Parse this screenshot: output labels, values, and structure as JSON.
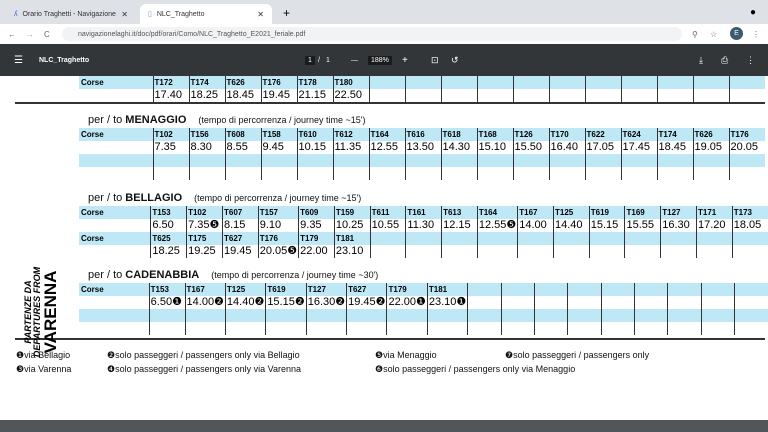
{
  "browser": {
    "tabs": [
      {
        "title": "Orario Traghetti - Navigazione",
        "active": false
      },
      {
        "title": "NLC_Traghetto",
        "active": true
      }
    ],
    "url": "navigazionelaghi.it/doc/pdf/orari/Como/NLC_Traghetto_E2021_feriale.pdf",
    "avatar": "E"
  },
  "pdf": {
    "title": "NLC_Traghetto",
    "page": "1",
    "pages": "1",
    "zoom": "188%"
  },
  "side_label": {
    "line1": "PARTENZE DA",
    "line2": "DEPARTURES FROM",
    "line3": "VARENNA"
  },
  "top_table": {
    "rows": [
      {
        "label": "Corse",
        "runs": [
          "T172",
          "T174",
          "T626",
          "T176",
          "T178",
          "T180"
        ],
        "times": [
          "17.40",
          "18.25",
          "18.45",
          "19.45",
          "21.15",
          "22.50"
        ]
      }
    ]
  },
  "sections": [
    {
      "prefix": "per / to",
      "dest": "MENAGGIO",
      "note": "(tempo di percorrenza / journey time ~15')",
      "rows": [
        {
          "label": "Corse",
          "runs": [
            "T102",
            "T156",
            "T608",
            "T158",
            "T610",
            "T612",
            "T164",
            "T616",
            "T618",
            "T168",
            "T126",
            "T170",
            "T622",
            "T624",
            "T174",
            "T626",
            "T176"
          ],
          "times": [
            "7.35",
            "8.30",
            "8.55",
            "9.45",
            "10.15",
            "11.35",
            "12.55",
            "13.50",
            "14.30",
            "15.10",
            "15.50",
            "16.40",
            "17.05",
            "17.45",
            "18.45",
            "19.05",
            "20.05"
          ]
        },
        {
          "label": "",
          "runs": [],
          "times": []
        }
      ]
    },
    {
      "prefix": "per / to",
      "dest": "BELLAGIO",
      "note": "(tempo di percorrenza / journey time ~15')",
      "rows": [
        {
          "label": "Corse",
          "runs": [
            "T153",
            "T102",
            "T607",
            "T157",
            "T609",
            "T159",
            "T611",
            "T161",
            "T613",
            "T164",
            "T167",
            "T125",
            "T619",
            "T169",
            "T127",
            "T171",
            "T173"
          ],
          "times": [
            "6.50",
            "7.35❺",
            "8.15",
            "9.10",
            "9.35",
            "10.25",
            "10.55",
            "11.30",
            "12.15",
            "12.55❺",
            "14.00",
            "14.40",
            "15.15",
            "15.55",
            "16.30",
            "17.20",
            "18.05"
          ]
        },
        {
          "label": "Corse",
          "runs": [
            "T625",
            "T175",
            "T627",
            "T176",
            "T179",
            "T181"
          ],
          "times": [
            "18.25",
            "19.25",
            "19.45",
            "20.05❺",
            "22.00",
            "23.10"
          ]
        }
      ]
    },
    {
      "prefix": "per / to",
      "dest": "CADENABBIA",
      "note": "(tempo di percorrenza / journey time ~30')",
      "rows": [
        {
          "label": "Corse",
          "runs": [
            "T153",
            "T167",
            "T125",
            "T619",
            "T127",
            "T627",
            "T179",
            "T181"
          ],
          "times": [
            "6.50❶",
            "14.00❷",
            "14.40❷",
            "15.15❷",
            "16.30❷",
            "19.45❷",
            "22.00❶",
            "23.10❶"
          ]
        },
        {
          "label": "",
          "runs": [],
          "times": []
        }
      ]
    }
  ],
  "legend": [
    {
      "mark": "❶",
      "text": "via Bellagio"
    },
    {
      "mark": "❷",
      "text": "solo passeggeri / passengers only via Bellagio"
    },
    {
      "mark": "❺",
      "text": "via Menaggio"
    },
    {
      "mark": "❼",
      "text": "solo passeggeri / passengers only"
    },
    {
      "mark": "❸",
      "text": "via Varenna"
    },
    {
      "mark": "❹",
      "text": "solo passeggeri / passengers only via Varenna"
    },
    {
      "mark": "❻",
      "text": "solo passeggeri / passengers only via Menaggio"
    }
  ]
}
